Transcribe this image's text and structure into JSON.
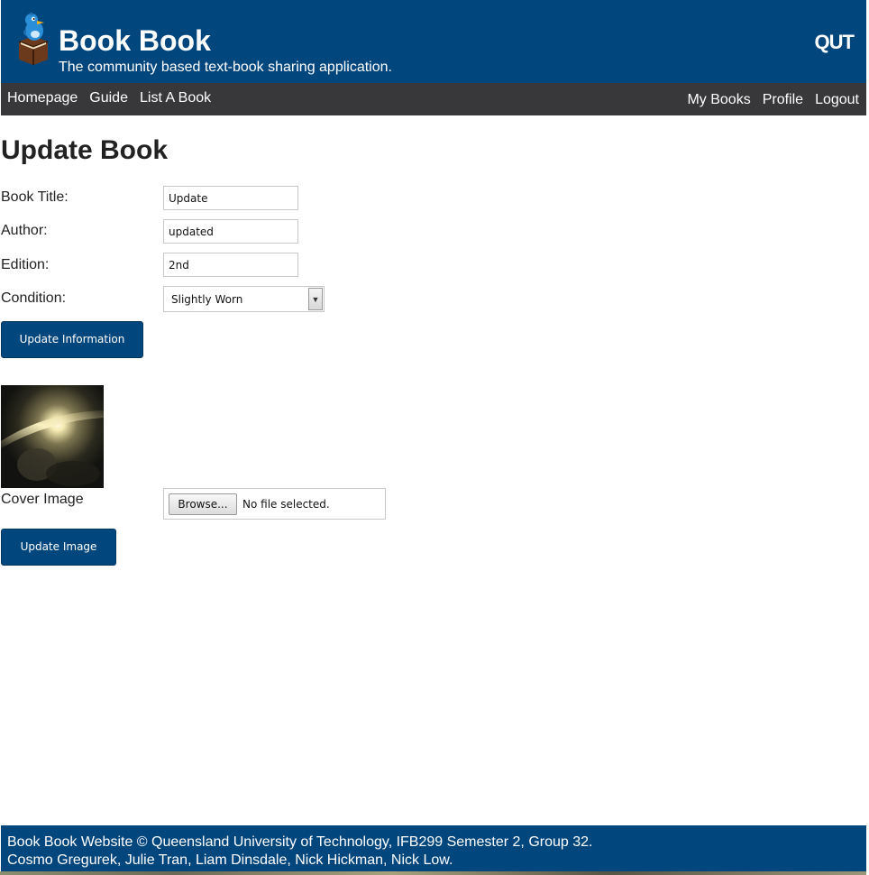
{
  "header": {
    "title": "Book Book",
    "tagline": "The community based text-book sharing application.",
    "logo_icon": "bookbook-mascot-logo",
    "partner_logo": "QUT"
  },
  "nav": {
    "left": [
      {
        "label": "Homepage"
      },
      {
        "label": "Guide"
      },
      {
        "label": "List A Book"
      }
    ],
    "right": [
      {
        "label": "My Books"
      },
      {
        "label": "Profile"
      },
      {
        "label": "Logout"
      }
    ]
  },
  "page": {
    "title": "Update Book"
  },
  "form": {
    "book_title": {
      "label": "Book Title:",
      "value": "Update"
    },
    "author": {
      "label": "Author:",
      "value": "updated"
    },
    "edition": {
      "label": "Edition:",
      "value": "2nd"
    },
    "condition": {
      "label": "Condition:",
      "selected": "Slightly Worn"
    },
    "update_info_button": "Update Information"
  },
  "image_form": {
    "cover_label": "Cover Image",
    "browse_button": "Browse...",
    "file_status": "No file selected.",
    "update_image_button": "Update Image"
  },
  "footer": {
    "line1": "Book Book Website © Queensland University of Technology, IFB299 Semester 2, Group 32.",
    "line2": "Cosmo Gregurek, Julie Tran, Liam Dinsdale, Nick Hickman, Nick Low."
  },
  "colors": {
    "brand_blue": "#02467e",
    "nav_dark": "#38383b"
  }
}
